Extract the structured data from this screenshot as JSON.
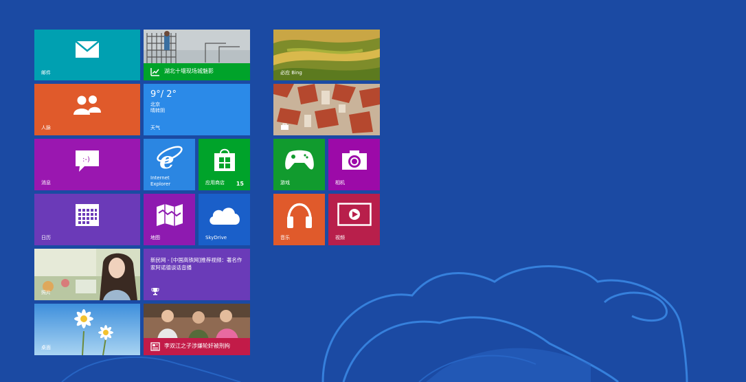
{
  "start_screen": {
    "tiles": {
      "mail": {
        "label": "邮件",
        "color": "#00a0b1",
        "icon": "envelope-icon"
      },
      "news_photo": {
        "label": "湖北十堰现场城魅影",
        "bar_color": "#00a32a",
        "icon": "chart-icon"
      },
      "people": {
        "label": "人脉",
        "color": "#e05a2b",
        "icon": "people-icon"
      },
      "weather": {
        "temp": "9°/ 2°",
        "city": "北京",
        "condition": "晴转阴",
        "label": "天气",
        "color": "#2b8ae8"
      },
      "messaging": {
        "label": "消息",
        "color": "#9a17b0",
        "icon": "chat-bubble-icon"
      },
      "ie": {
        "label": "Internet Explorer",
        "label_line1": "Internet",
        "label_line2": "Explorer",
        "color": "#2b86e2",
        "icon": "ie-icon"
      },
      "store": {
        "label": "应用商店",
        "badge": "15",
        "color": "#00a32a",
        "icon": "store-bag-icon"
      },
      "calendar": {
        "label": "日历",
        "color": "#6b3ab8",
        "icon": "calendar-icon"
      },
      "maps": {
        "label": "地图",
        "color": "#8e1ab0",
        "icon": "map-icon"
      },
      "skydrive": {
        "label": "SkyDrive",
        "color": "#1a5fc9",
        "icon": "cloud-icon"
      },
      "photos": {
        "label": "照片",
        "icon": "photo"
      },
      "news_text": {
        "headline": "新民网 - [中国高铁网]推荐视频：著名作家阿诺德谈话音播",
        "color": "#6a3bb8",
        "icon": "trophy-icon"
      },
      "desktop": {
        "label": "桌面"
      },
      "news_bottom": {
        "label": "李双江之子涉嫌轮奸被刑拘",
        "bar_color": "#c21b48",
        "icon": "newspaper-icon"
      },
      "bing": {
        "label": "必应 Bing"
      },
      "travel": {
        "icon": "suitcase-icon"
      },
      "games": {
        "label": "游戏",
        "color": "#119b2e",
        "icon": "xbox-controller-icon"
      },
      "camera": {
        "label": "相机",
        "color": "#9c0aa8",
        "icon": "camera-icon"
      },
      "music": {
        "label": "音乐",
        "color": "#e05a2b",
        "icon": "headphones-icon"
      },
      "video": {
        "label": "视频",
        "color": "#b81f4b",
        "icon": "play-icon"
      }
    }
  }
}
